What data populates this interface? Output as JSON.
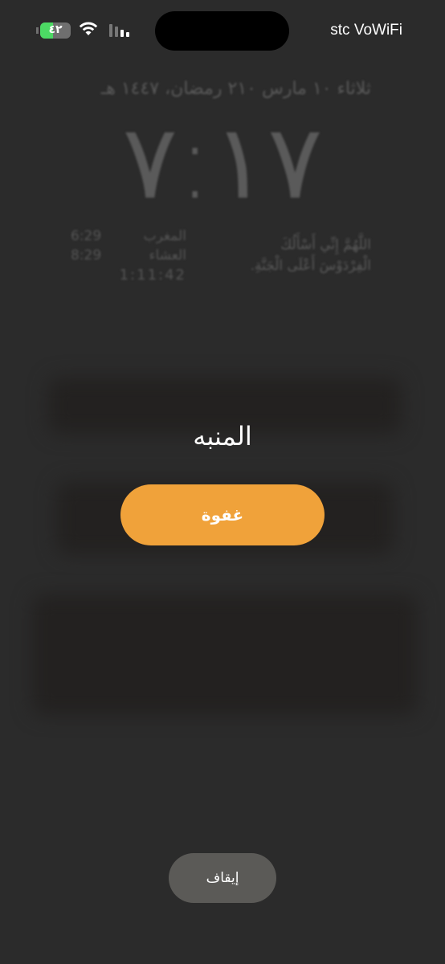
{
  "status_bar": {
    "carrier": "stc VoWiFi",
    "battery_text": "٤٢",
    "battery_level": 0.42,
    "battery_color": "#4cd964"
  },
  "lock_screen": {
    "date_line": "ثلاثاء ١٠ مارس ٢١٠ رمضان، ١٤٤٧ هـ",
    "time": "٧:١٧",
    "prayers": [
      {
        "name": "المغرب",
        "time": "6:29"
      },
      {
        "name": "العشاء",
        "time": "8:29"
      }
    ],
    "countdown": "1:11:42",
    "dua_line_1": "اللَّهُمَّ إِنِّي أَسْأَلُكَ",
    "dua_line_2": "الْفِرْدَوْسَ أَعْلَى الْجَنَّةِ."
  },
  "alarm": {
    "title": "المنبه",
    "snooze_label": "غفوة",
    "stop_label": "إيقاف",
    "accent_color": "#f0a23a"
  }
}
